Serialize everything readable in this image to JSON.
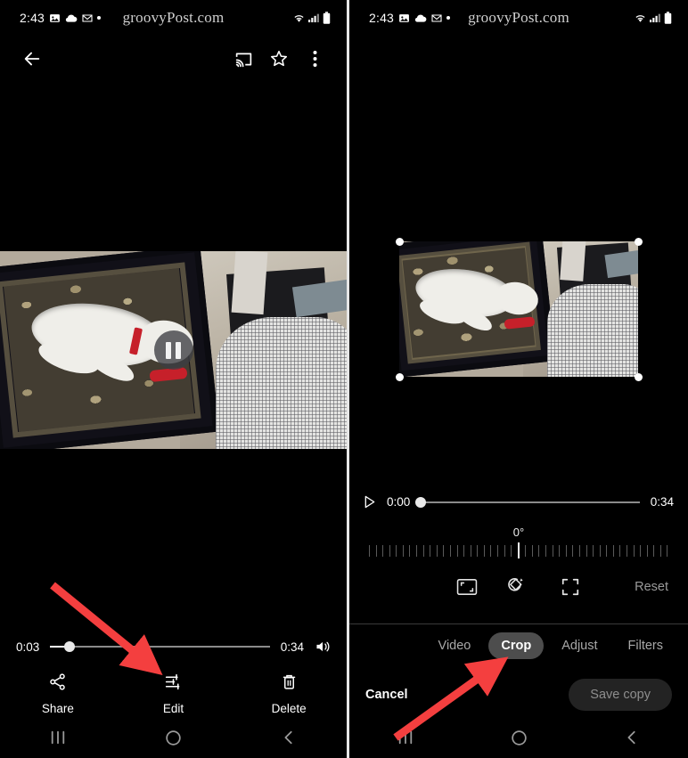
{
  "status_bar": {
    "time": "2:43",
    "icons_left": [
      "photo-icon",
      "cloud-icon",
      "gmail-icon",
      "dot-icon"
    ],
    "icons_right": [
      "wifi-icon",
      "signal-icon",
      "battery-icon"
    ],
    "watermark": "groovyPost.com"
  },
  "left_panel": {
    "toolbar": {
      "back": "back-arrow-icon",
      "cast": "cast-icon",
      "star": "star-icon",
      "more": "more-vert-icon"
    },
    "player": {
      "play_state": "pause-icon",
      "current_time": "0:03",
      "total_time": "0:34",
      "progress_percent": 9,
      "volume": "volume-icon"
    },
    "actions": [
      {
        "label": "Share",
        "icon": "share-icon"
      },
      {
        "label": "Edit",
        "icon": "edit-sliders-icon"
      },
      {
        "label": "Delete",
        "icon": "trash-icon"
      }
    ]
  },
  "right_panel": {
    "player": {
      "play_state": "play-icon",
      "current_time": "0:00",
      "total_time": "0:34",
      "progress_percent": 0
    },
    "rotation": {
      "value": "0°",
      "tick_count": 45
    },
    "crop_tools": [
      {
        "name": "aspect-ratio-icon"
      },
      {
        "name": "rotate-icon"
      },
      {
        "name": "free-crop-icon"
      }
    ],
    "reset_label": "Reset",
    "tabs": [
      {
        "label": "Video",
        "active": false
      },
      {
        "label": "Crop",
        "active": true
      },
      {
        "label": "Adjust",
        "active": false
      },
      {
        "label": "Filters",
        "active": false
      }
    ],
    "cancel_label": "Cancel",
    "save_label": "Save copy"
  },
  "nav_bar": {
    "recents": "recents-icon",
    "home": "home-icon",
    "back": "back-icon"
  },
  "annotations": {
    "arrow_color": "#f43f3f",
    "left_arrow_target": "Edit",
    "right_arrow_target": "Crop"
  }
}
